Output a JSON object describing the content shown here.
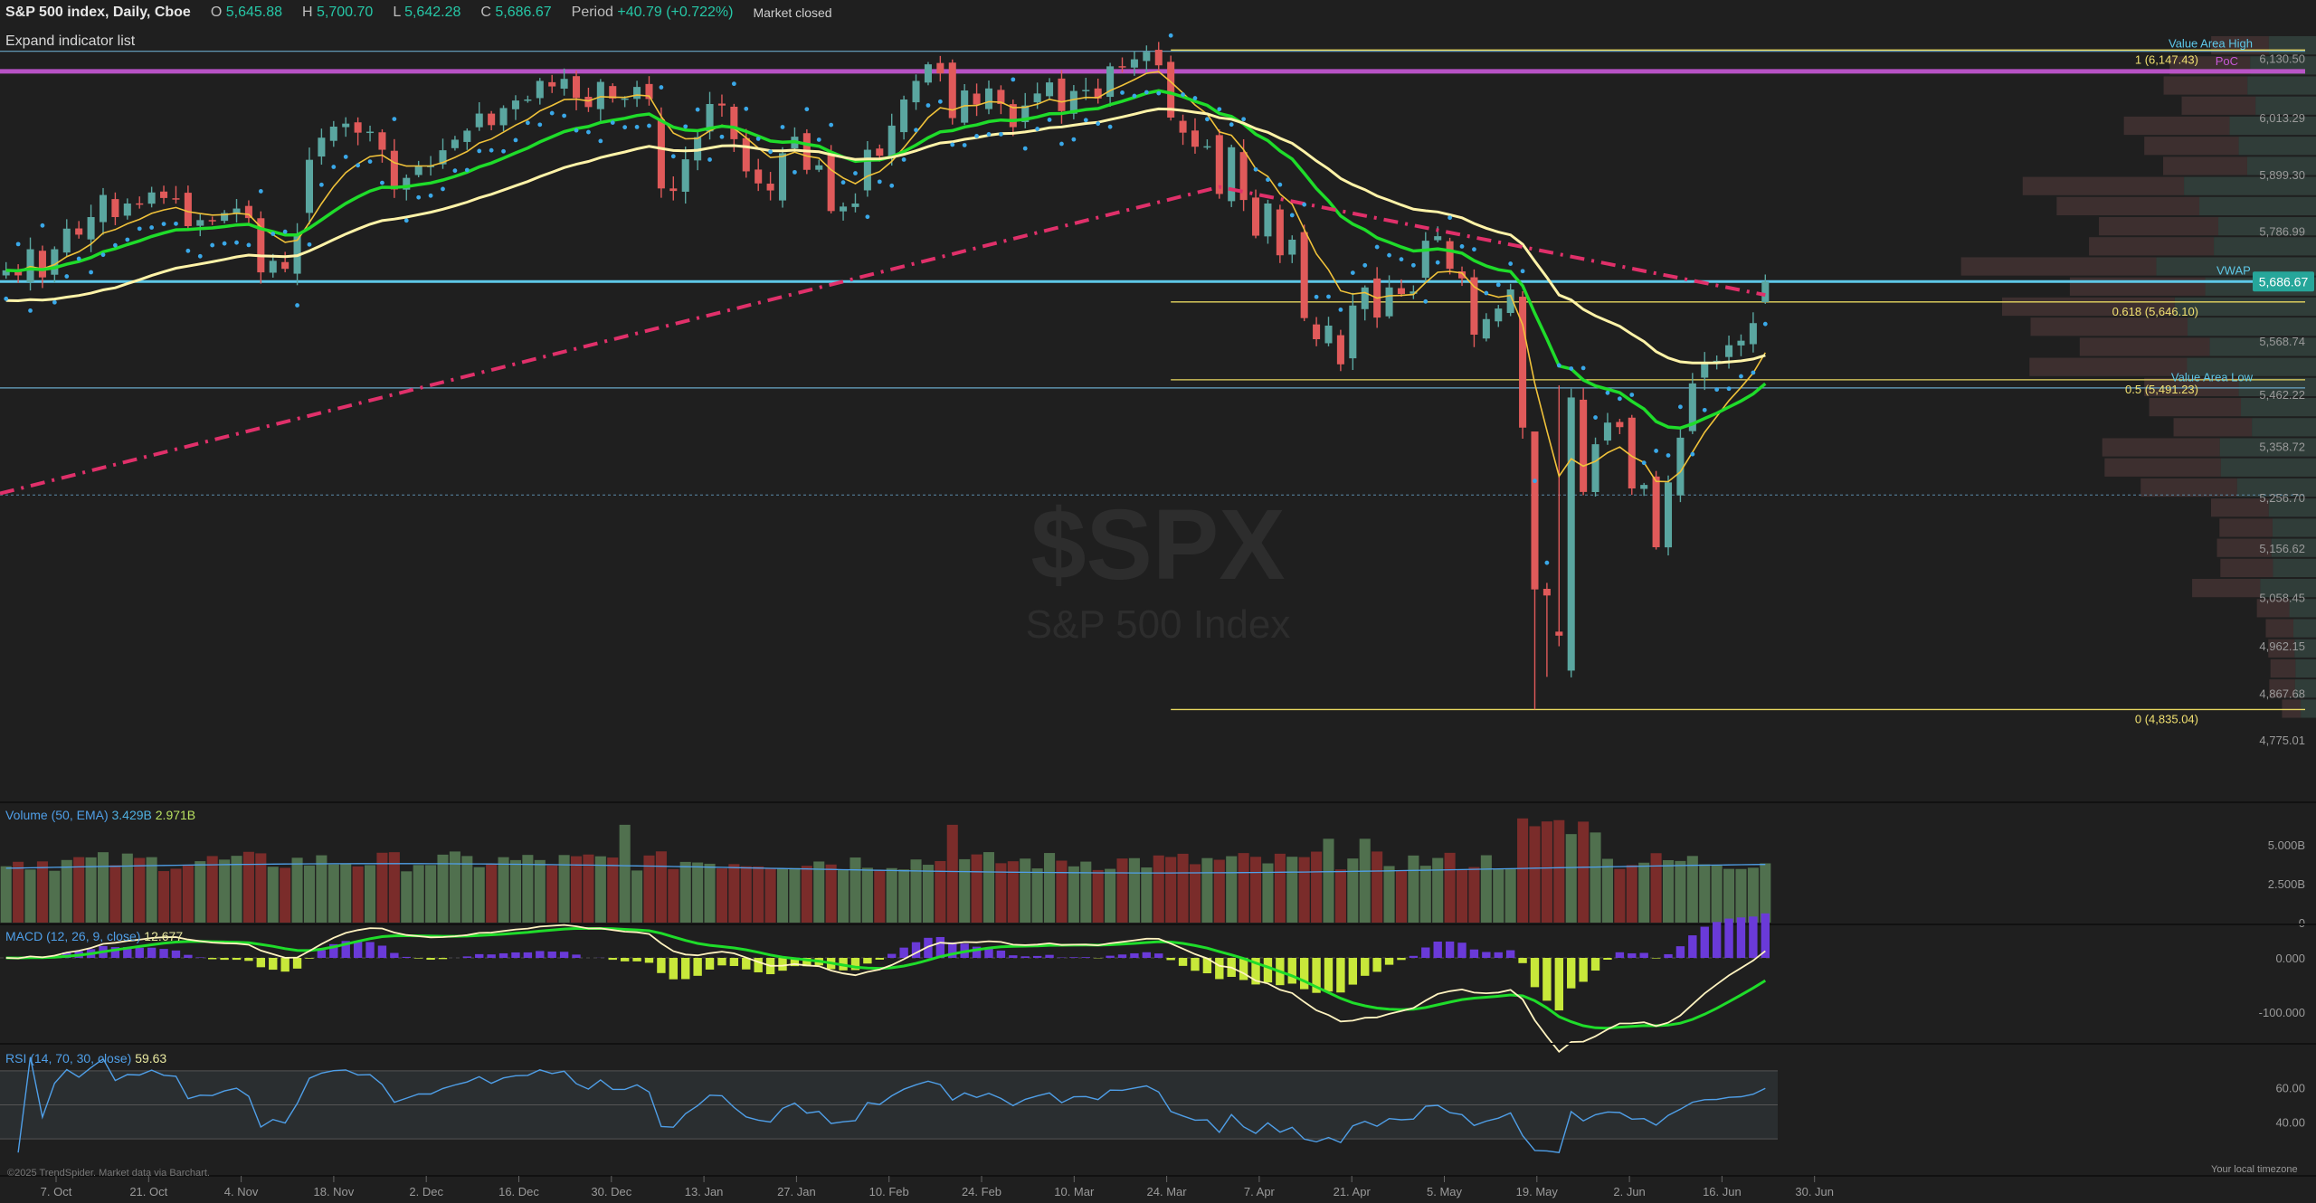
{
  "header": {
    "symbol": "S&P 500 index, Daily, Cboe",
    "o_label": "O",
    "o_value": "5,645.88",
    "h_label": "H",
    "h_value": "5,700.70",
    "l_label": "L",
    "l_value": "5,642.28",
    "c_label": "C",
    "c_value": "5,686.67",
    "period_label": "Period",
    "period_value": "+40.79 (+0.722%)",
    "status": "Market closed"
  },
  "expand_indicator_list": "Expand indicator list",
  "watermark": {
    "ticker": "$SPX",
    "name": "S&P 500 Index"
  },
  "colors": {
    "up": "#5aa6a0",
    "down": "#e05a5a",
    "ema_fast": "#f0c23a",
    "ema_mid": "#1fdc2a",
    "ema_slow": "#fff3a8",
    "sma200": "#e0306a",
    "poc": "#c858d8",
    "vwap": "#5ec8e8",
    "psar": "#3aa8e8"
  },
  "chart_data": [
    {
      "type": "candlestick",
      "title": "S&P 500 index, Daily, Cboe",
      "y_axis_ticks": [
        "6,130.50",
        "6,013.29",
        "5,899.30",
        "5,786.99",
        "5,686.67",
        "5,568.74",
        "5,462.22",
        "5,358.72",
        "5,256.70",
        "5,156.62",
        "5,058.45",
        "4,962.15",
        "4,867.68",
        "4,775.01"
      ],
      "x_axis_ticks": [
        "7. Oct",
        "21. Oct",
        "4. Nov",
        "18. Nov",
        "2. Dec",
        "16. Dec",
        "30. Dec",
        "13. Jan",
        "27. Jan",
        "10. Feb",
        "24. Feb",
        "10. Mar",
        "24. Mar",
        "7. Apr",
        "21. Apr",
        "5. May",
        "19. May",
        "2. Jun",
        "16. Jun",
        "30. Jun"
      ],
      "ylim": [
        4735,
        6175
      ],
      "last_price_label": "5,686.67",
      "fib_levels": [
        {
          "label": "1 (6,147.43)",
          "value": 6147.43
        },
        {
          "label": "0.618 (5,646.10)",
          "value": 5646.1
        },
        {
          "label": "0.5 (5,491.23)",
          "value": 5491.23
        },
        {
          "label": "0 (4,835.04)",
          "value": 4835.04
        }
      ],
      "annotations": [
        {
          "label": "Value Area High",
          "value": 6160
        },
        {
          "label": "PoC",
          "value": 6105
        },
        {
          "label": "VWAP",
          "value": 5686.67
        },
        {
          "label": "Value Area Low",
          "value": 5485
        }
      ],
      "volume_profile_note": "horizontal volume-by-price histogram on right side",
      "dates": [
        "2024-10-02",
        "2024-10-03",
        "2024-10-04",
        "2024-10-07",
        "2024-10-08",
        "2024-10-09",
        "2024-10-10",
        "2024-10-11",
        "2024-10-14",
        "2024-10-15",
        "2024-10-16",
        "2024-10-17",
        "2024-10-18",
        "2024-10-21",
        "2024-10-22",
        "2024-10-23",
        "2024-10-24",
        "2024-10-25",
        "2024-10-28",
        "2024-10-29",
        "2024-10-30",
        "2024-10-31",
        "2024-11-01",
        "2024-11-04",
        "2024-11-05",
        "2024-11-06",
        "2024-11-07",
        "2024-11-08",
        "2024-11-11",
        "2024-11-12",
        "2024-11-13",
        "2024-11-14",
        "2024-11-15",
        "2024-11-18",
        "2024-11-19",
        "2024-11-20",
        "2024-11-21",
        "2024-11-22",
        "2024-11-25",
        "2024-11-26",
        "2024-11-27",
        "2024-11-29",
        "2024-12-02",
        "2024-12-03",
        "2024-12-04",
        "2024-12-05",
        "2024-12-06",
        "2024-12-09",
        "2024-12-10",
        "2024-12-11",
        "2024-12-12",
        "2024-12-13",
        "2024-12-16",
        "2024-12-17",
        "2024-12-18",
        "2024-12-19",
        "2024-12-20",
        "2024-12-23",
        "2024-12-24",
        "2024-12-26",
        "2024-12-27",
        "2024-12-30",
        "2024-12-31",
        "2025-01-02",
        "2025-01-03",
        "2025-01-06",
        "2025-01-07",
        "2025-01-08",
        "2025-01-10",
        "2025-01-13",
        "2025-01-14",
        "2025-01-15",
        "2025-01-16",
        "2025-01-17",
        "2025-01-21",
        "2025-01-22",
        "2025-01-23",
        "2025-01-24",
        "2025-01-27",
        "2025-01-28",
        "2025-01-29",
        "2025-01-30",
        "2025-01-31",
        "2025-02-03",
        "2025-02-04",
        "2025-02-05",
        "2025-02-06",
        "2025-02-07",
        "2025-02-10",
        "2025-02-11",
        "2025-02-12",
        "2025-02-13",
        "2025-02-14",
        "2025-02-18",
        "2025-02-19",
        "2025-02-20",
        "2025-02-21",
        "2025-02-24",
        "2025-02-25",
        "2025-02-26",
        "2025-02-27",
        "2025-02-28",
        "2025-03-03",
        "2025-03-04",
        "2025-03-05",
        "2025-03-06",
        "2025-03-07",
        "2025-03-10",
        "2025-03-11",
        "2025-03-12",
        "2025-03-13",
        "2025-03-14",
        "2025-03-17",
        "2025-03-18",
        "2025-03-19",
        "2025-03-20",
        "2025-03-21",
        "2025-03-24",
        "2025-03-25",
        "2025-03-26",
        "2025-03-27",
        "2025-03-28",
        "2025-03-31",
        "2025-04-01",
        "2025-04-02",
        "2025-04-03",
        "2025-04-04",
        "2025-04-07",
        "2025-04-08",
        "2025-04-09",
        "2025-04-10",
        "2025-04-11",
        "2025-04-14",
        "2025-04-15",
        "2025-04-16",
        "2025-04-17",
        "2025-04-21",
        "2025-04-22",
        "2025-04-23",
        "2025-04-24",
        "2025-04-25",
        "2025-04-28",
        "2025-04-29",
        "2025-04-30",
        "2025-05-01",
        "2025-05-02"
      ],
      "close": [
        5709,
        5699,
        5751,
        5695,
        5751,
        5792,
        5780,
        5815,
        5859,
        5815,
        5842,
        5841,
        5864,
        5853,
        5851,
        5797,
        5809,
        5808,
        5823,
        5832,
        5813,
        5705,
        5728,
        5712,
        5782,
        5929,
        5973,
        5995,
        6001,
        5983,
        5985,
        5949,
        5870,
        5893,
        5917,
        5917,
        5948,
        5969,
        5987,
        6021,
        5998,
        6032,
        6047,
        6049,
        6086,
        6075,
        6090,
        6052,
        6034,
        6084,
        6051,
        6051,
        6074,
        6050,
        5872,
        5867,
        5930,
        5974,
        6040,
        6037,
        5970,
        5906,
        5882,
        5868,
        5942,
        5975,
        5909,
        5918,
        5827,
        5836,
        5842,
        5949,
        5937,
        5997,
        6049,
        6086,
        6119,
        6101,
        6012,
        6067,
        6039,
        6071,
        6040,
        5994,
        6037,
        6061,
        6083,
        6026,
        6066,
        6068,
        6051,
        6115,
        6114,
        6129,
        6144,
        6117,
        6013,
        5983,
        5955,
        5956,
        5861,
        5954,
        5849,
        5778,
        5842,
        5739,
        5770,
        5614,
        5572,
        5599,
        5522,
        5639,
        5675,
        5615,
        5675,
        5662,
        5667,
        5768,
        5777,
        5712,
        5693,
        5581,
        5612,
        5633,
        5671,
        5396,
        5074,
        5062,
        4982,
        5456,
        5268,
        5363,
        5406,
        5397,
        5275,
        5282,
        5158,
        5287,
        5376,
        5484,
        5525,
        5529,
        5560,
        5569,
        5604,
        5687
      ],
      "volume_axis_ticks": [
        "5.000B",
        "2.500B",
        "0"
      ],
      "volume_label": "Volume (50, EMA)",
      "volume_values_label": [
        "3.429B",
        "2.971B"
      ],
      "macd_label": "MACD (12, 26, 9, close)",
      "macd_value_label": "12.677",
      "macd_axis_ticks": [
        "0.000",
        "-100.000"
      ],
      "rsi_label": "RSI (14, 70, 30, close)",
      "rsi_value_label": "59.63",
      "rsi_axis_ticks": [
        "60.00",
        "40.00"
      ],
      "footer_left": "©2025 TrendSpider. Market data via Barchart.",
      "footer_right": "Your local timezone"
    }
  ]
}
